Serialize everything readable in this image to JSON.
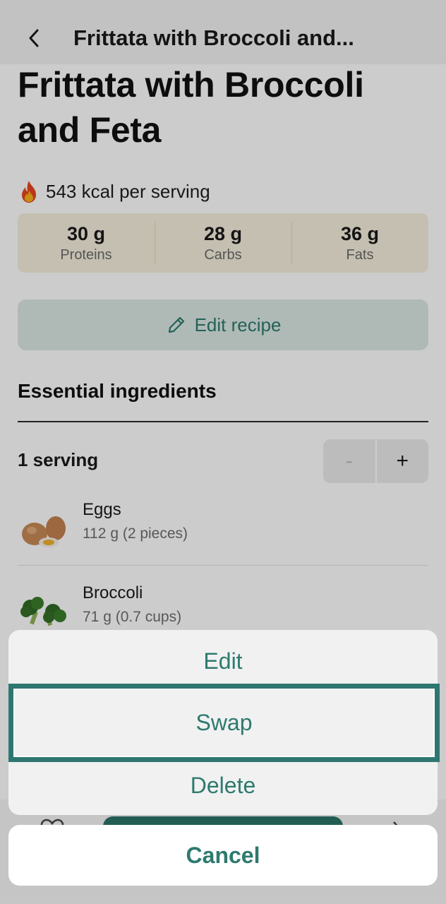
{
  "header": {
    "title": "Frittata with Broccoli and..."
  },
  "recipe": {
    "title": "Frittata with Broccoli and Feta",
    "kcal_text": "543 kcal per serving",
    "macros": [
      {
        "value": "30 g",
        "label": "Proteins"
      },
      {
        "value": "28 g",
        "label": "Carbs"
      },
      {
        "value": "36 g",
        "label": "Fats"
      }
    ],
    "edit_label": "Edit recipe"
  },
  "ingredients": {
    "section_title": "Essential ingredients",
    "serving_label": "1 serving",
    "stepper": {
      "minus": "-",
      "plus": "+"
    },
    "items": [
      {
        "name": "Eggs",
        "qty": "112 g (2 pieces)",
        "icon": "eggs-image"
      },
      {
        "name": "Broccoli",
        "qty": "71 g (0.7 cups)",
        "icon": "broccoli-image"
      }
    ]
  },
  "action_sheet": {
    "options": [
      "Edit",
      "Swap",
      "Delete"
    ],
    "cancel": "Cancel",
    "selected": "Swap"
  },
  "colors": {
    "accent": "#2e7a6e",
    "macros_bg": "#f6efdc",
    "edit_bg": "#dbe9e4",
    "highlight_border": "#2e7770"
  }
}
